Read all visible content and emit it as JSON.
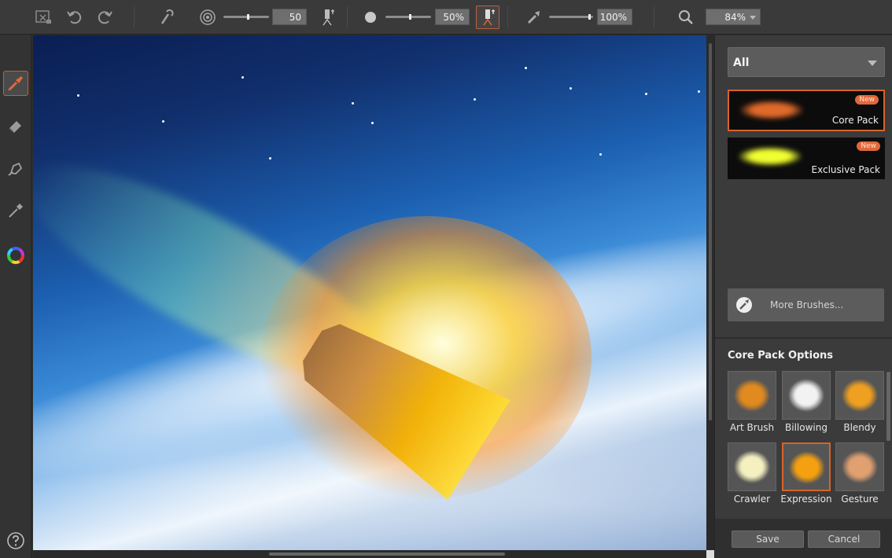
{
  "toolbar": {
    "brush_size_value": "50",
    "brush_opacity_value": "50%",
    "brush_flow_value": "100%",
    "zoom_value": "84%",
    "brush_size_level": 0.55,
    "brush_opacity_level": 0.55,
    "brush_flow_level": 0.95
  },
  "left_tools": [
    {
      "icon": "brush-icon",
      "active": true
    },
    {
      "icon": "eraser-icon",
      "active": false
    },
    {
      "icon": "smudge-icon",
      "active": false
    },
    {
      "icon": "eyedropper-icon",
      "active": false
    },
    {
      "icon": "color-wheel-icon",
      "active": false
    }
  ],
  "right_panel": {
    "category_value": "All",
    "packs": [
      {
        "name": "Core Pack",
        "badge": "New",
        "selected": true,
        "color": "#e06a2a"
      },
      {
        "name": "Exclusive Pack",
        "badge": "New",
        "selected": false,
        "color": "#f0ff30"
      }
    ],
    "more_brushes_label": "More Brushes...",
    "options_title": "Core Pack Options",
    "brushes": [
      {
        "label": "Art Brush",
        "selected": false,
        "color": "#e08a20"
      },
      {
        "label": "Billowing",
        "selected": false,
        "color": "#f2f2f2"
      },
      {
        "label": "Blendy",
        "selected": false,
        "color": "#f0a020"
      },
      {
        "label": "Crawler",
        "selected": false,
        "color": "#f5f0c0"
      },
      {
        "label": "Expression",
        "selected": true,
        "color": "#f5a010"
      },
      {
        "label": "Gesture",
        "selected": false,
        "color": "#e0a070"
      }
    ],
    "save_label": "Save",
    "cancel_label": "Cancel"
  },
  "colors": {
    "accent": "#d5642a",
    "panel": "#3b3b3b",
    "toolbar": "#3a3a3a"
  }
}
